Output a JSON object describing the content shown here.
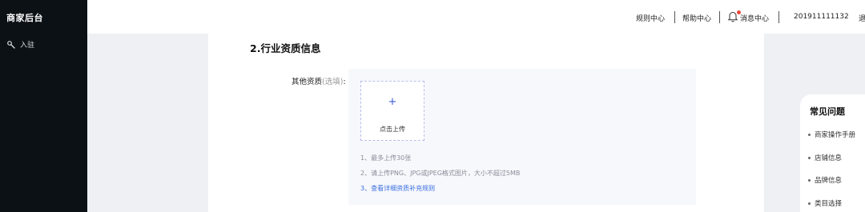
{
  "app": {
    "title": "商家后台"
  },
  "sidebar": {
    "items": [
      {
        "label": "入驻",
        "icon": "wrench-icon"
      }
    ]
  },
  "topbar": {
    "links": [
      "规则中心",
      "帮助中心",
      "消息中心"
    ],
    "account": "201911111132",
    "cutoff_text": "退",
    "bell_icon": "bell-icon",
    "notification_dot_color": "#e84a3c"
  },
  "main": {
    "section_title": "2.行业资质信息",
    "field_label": "其他资质",
    "field_optional": "(选填)",
    "field_colon": ":",
    "upload": {
      "plus": "+",
      "label": "点击上传",
      "notes": [
        "1、最多上传30张",
        "2、请上传PNG、JPG或JPEG格式图片，大小不超过5MB",
        "3、查看详细资质补充规则"
      ],
      "link_color": "#3a6ee0"
    }
  },
  "faq": {
    "title": "常见问题",
    "items": [
      "商家操作手册",
      "店铺信息",
      "品牌信息",
      "类目选择"
    ]
  },
  "colors": {
    "accent": "#3a5cd6",
    "sidebar_bg": "#0c1116",
    "page_bg": "#eef0f3"
  }
}
